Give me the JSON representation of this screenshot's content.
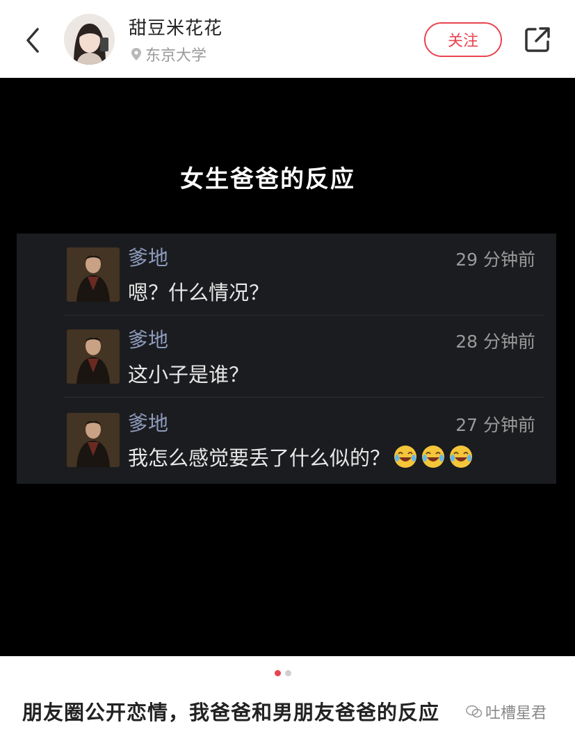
{
  "header": {
    "author_name": "甜豆米花花",
    "location": "东京大学",
    "follow_label": "关注"
  },
  "image": {
    "title": "女生爸爸的反应",
    "comments": [
      {
        "name": "爹地",
        "time": "29 分钟前",
        "text": "嗯？什么情况？",
        "emoji_count": 0
      },
      {
        "name": "爹地",
        "time": "28 分钟前",
        "text": "这小子是谁？",
        "emoji_count": 0
      },
      {
        "name": "爹地",
        "time": "27 分钟前",
        "text": "我怎么感觉要丢了什么似的？",
        "emoji_count": 3
      }
    ],
    "page_indicator": {
      "current": 1,
      "total": 2
    }
  },
  "post": {
    "title": "朋友圈公开恋情，我爸爸和男朋友爸爸的反应"
  },
  "watermark": "吐槽星君",
  "colors": {
    "accent": "#e9434f",
    "commenter_name": "#8e9bbd",
    "panel_bg": "#1b1c1f"
  },
  "icons": {
    "back": "chevron-left-icon",
    "share": "share-icon",
    "location": "location-pin-icon",
    "emoji": "laughing-crying-emoji"
  }
}
